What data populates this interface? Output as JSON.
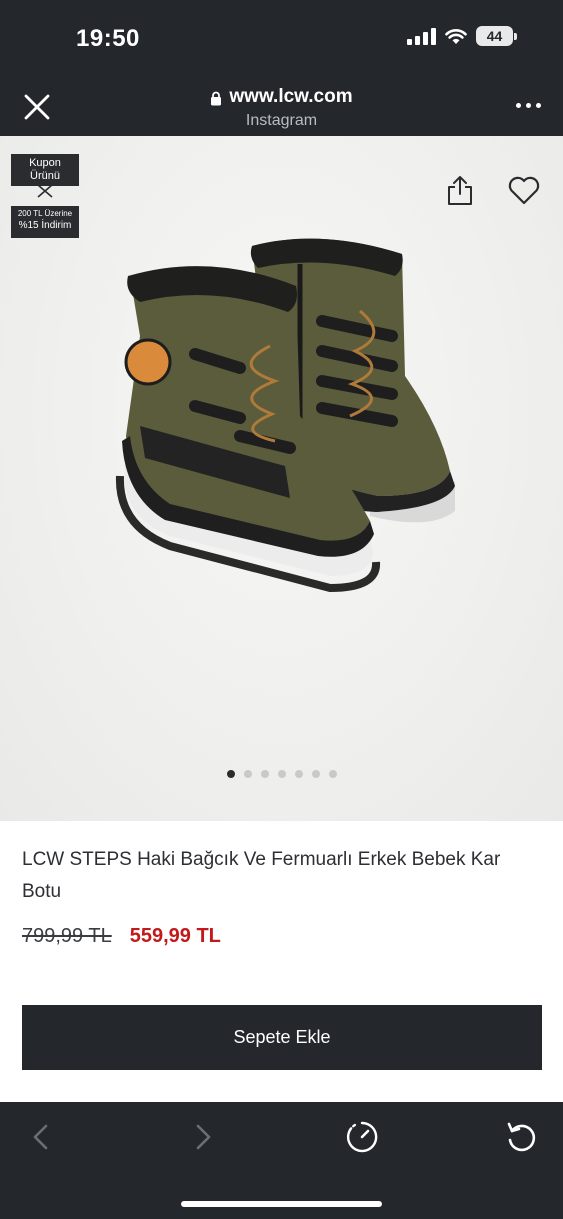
{
  "status_bar": {
    "time": "19:50",
    "battery": "44"
  },
  "browser": {
    "url": "www.lcw.com",
    "source": "Instagram"
  },
  "badge": {
    "coupon_line1": "Kupon",
    "coupon_line2": "Ürünü",
    "offer_line1": "200 TL Üzerine",
    "offer_line2": "%15 İndirim"
  },
  "carousel": {
    "dots": 7,
    "active_index": 0
  },
  "product": {
    "title": "LCW STEPS Haki Bağcık Ve Fermuarlı Erkek Bebek Kar Botu",
    "old_price": "799,99 TL",
    "new_price": "559,99 TL"
  },
  "cta": {
    "add_to_cart": "Sepete Ekle"
  },
  "colors": {
    "dark": "#24272c",
    "sale_red": "#c01a1a",
    "boot_khaki": "#5a5c3c"
  },
  "icons": [
    "close-icon",
    "lock-icon",
    "more-icon",
    "share-icon",
    "heart-icon",
    "back-icon",
    "forward-icon",
    "speed-icon",
    "reload-icon"
  ]
}
